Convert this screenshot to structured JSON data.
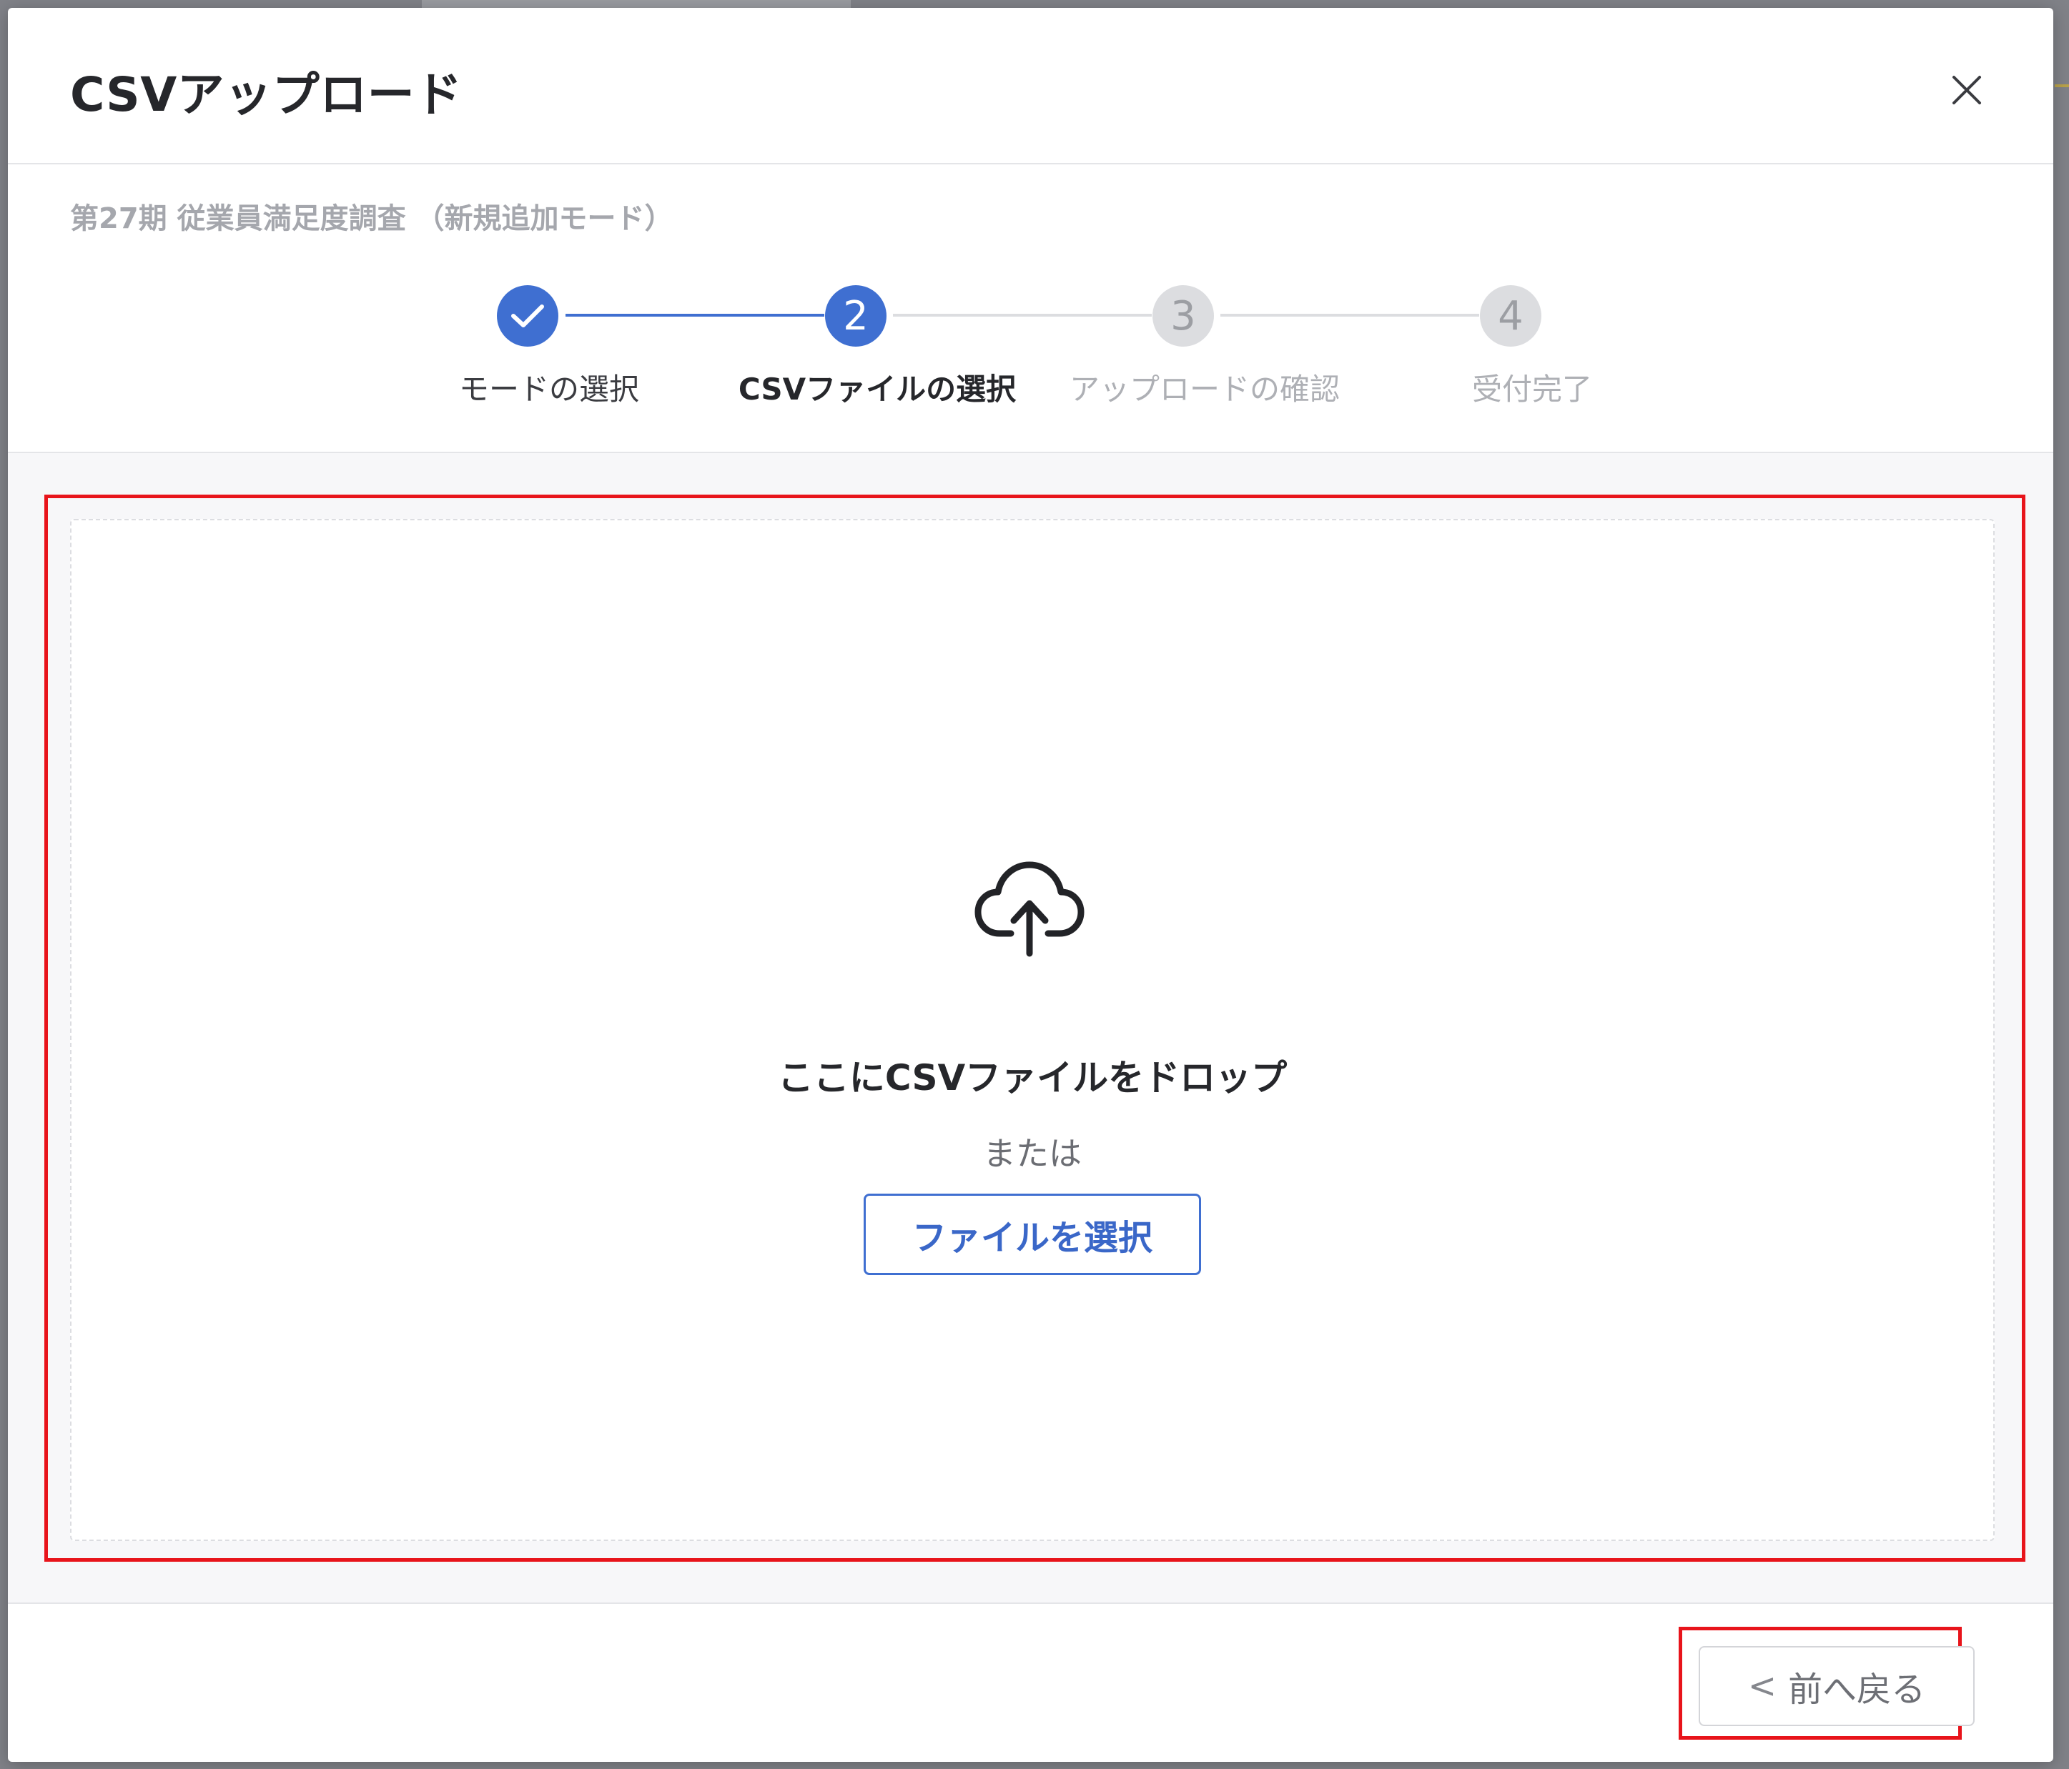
{
  "modal": {
    "title": "CSVアップロード",
    "subtitle": "第27期 従業員満足度調査 （新規追加モード）"
  },
  "stepper": {
    "steps": [
      {
        "number": "1",
        "label": "モードの選択",
        "state": "completed"
      },
      {
        "number": "2",
        "label": "CSVファイルの選択",
        "state": "active"
      },
      {
        "number": "3",
        "label": "アップロードの確認",
        "state": "pending"
      },
      {
        "number": "4",
        "label": "受付完了",
        "state": "pending"
      }
    ]
  },
  "dropzone": {
    "title": "ここにCSVファイルをドロップ",
    "or_text": "または",
    "select_button": "ファイルを選択",
    "icon": "cloud-upload-icon"
  },
  "footer": {
    "back_button": "前へ戻る",
    "back_chevron": "<"
  },
  "colors": {
    "accent": "#3f6fd1",
    "highlight": "#e8141b",
    "pending": "#d9dadd"
  }
}
